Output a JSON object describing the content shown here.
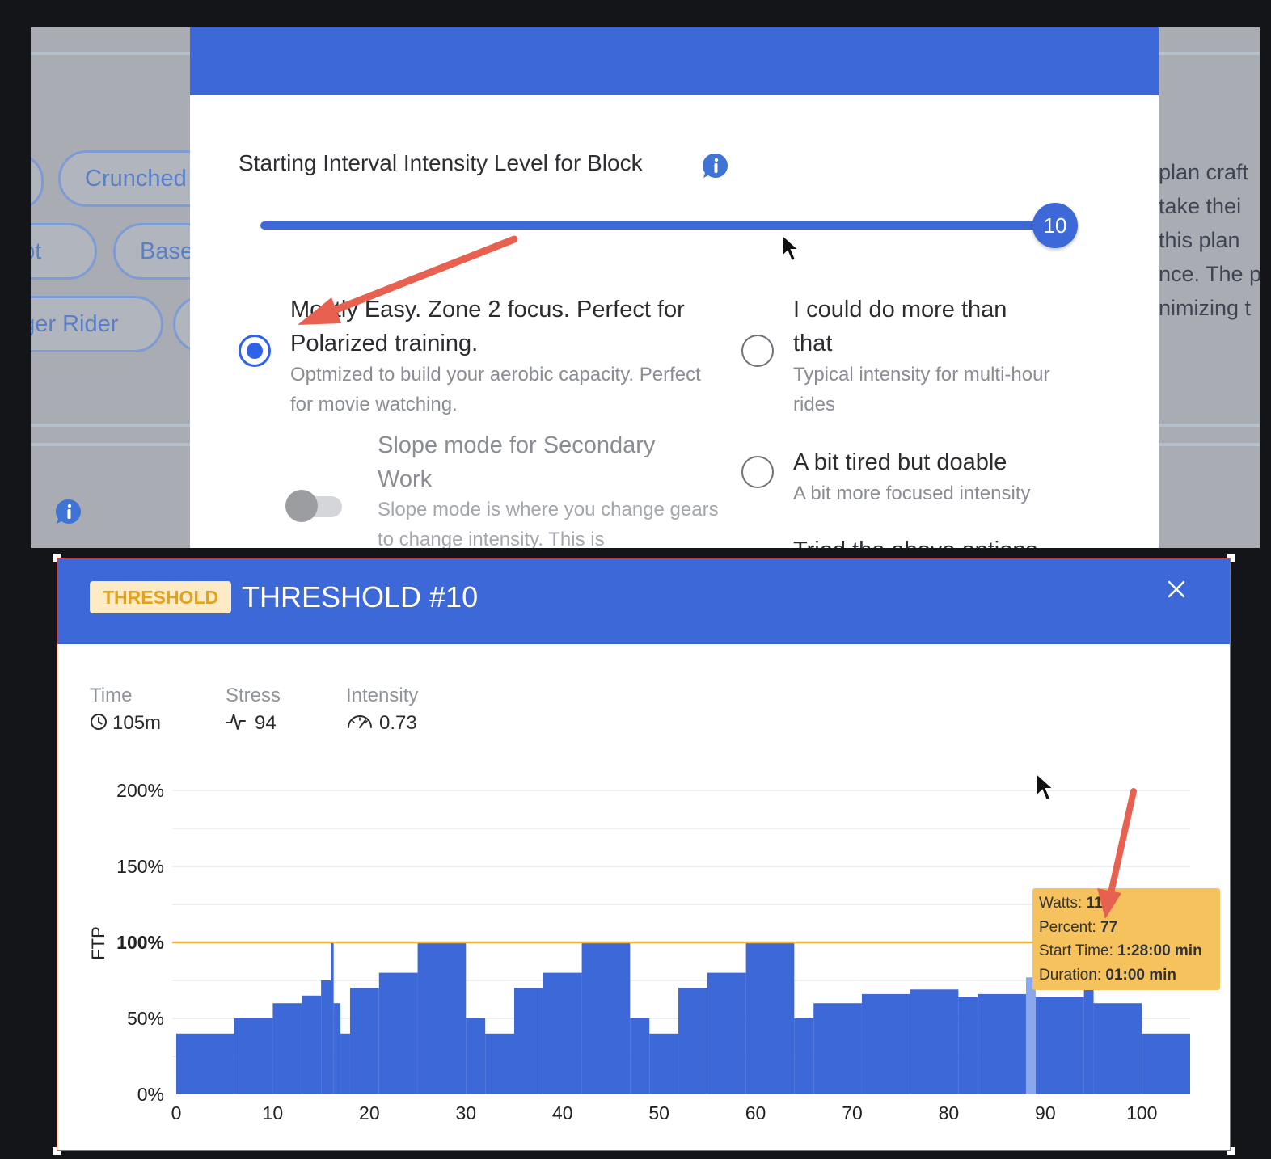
{
  "background_tags": {
    "row1": [
      "Crunched"
    ],
    "row2": [
      "pot",
      "Base"
    ],
    "row3": [
      "nger Rider"
    ]
  },
  "background_text": [
    "plan craft",
    "take thei",
    "this plan",
    "nce. The p",
    "nimizing t"
  ],
  "intensity_panel": {
    "title": "Starting Interval Intensity Level for Block",
    "slider_value": "10",
    "options": [
      {
        "title": "Mostly Easy. Zone 2 focus. Perfect for Polarized training.",
        "desc": "Optmized to build your aerobic capacity. Perfect for movie watching.",
        "selected": true
      },
      {
        "title": "I could do more than that",
        "desc": "Typical intensity for multi-hour rides",
        "selected": false
      },
      {
        "title": "A bit tired but doable",
        "desc": "A bit more focused intensity",
        "selected": false
      },
      {
        "title": "Tried the above options",
        "desc": "",
        "selected": false
      }
    ],
    "slope_mode": {
      "title": "Slope mode for Secondary Work",
      "desc": "Slope mode is where you change gears to change intensity. This is",
      "enabled": false
    }
  },
  "workout": {
    "badge": "THRESHOLD",
    "title": "THRESHOLD #10",
    "stats": [
      {
        "label": "Time",
        "value": "105m",
        "icon": "clock-icon"
      },
      {
        "label": "Stress",
        "value": "94",
        "icon": "pulse-icon"
      },
      {
        "label": "Intensity",
        "value": "0.73",
        "icon": "speedometer-icon"
      }
    ],
    "tooltip": {
      "watts_label": "Watts:",
      "watts_value": "11",
      "percent_label": "Percent:",
      "percent_value": "77",
      "start_label": "Start Time:",
      "start_value": "1:28:00 min",
      "duration_label": "Duration:",
      "duration_value": "01:00 min"
    }
  },
  "colors": {
    "accent": "#3d68d8",
    "ftp_line": "#f2b43c",
    "tooltip": "#f6c25d",
    "badge_text": "#e3a21c",
    "annotation_arrow": "#e8604f"
  },
  "chart_data": {
    "type": "area",
    "title": "",
    "xlabel": "",
    "ylabel": "FTP",
    "xlim": [
      0,
      105
    ],
    "ylim": [
      0,
      200
    ],
    "x_ticks": [
      0,
      10,
      20,
      30,
      40,
      50,
      60,
      70,
      80,
      90,
      100
    ],
    "y_ticks": [
      0,
      50,
      100,
      150,
      200
    ],
    "y_tick_labels": [
      "0%",
      "50%",
      "100%",
      "150%",
      "200%"
    ],
    "reference_line": {
      "y": 100,
      "label": "100%"
    },
    "highlight_segment": {
      "start": 88,
      "end": 89
    },
    "segments": [
      {
        "start": 0,
        "end": 6,
        "value": 40
      },
      {
        "start": 6,
        "end": 10,
        "value": 50
      },
      {
        "start": 10,
        "end": 13,
        "value": 60
      },
      {
        "start": 13,
        "end": 15,
        "value": 65
      },
      {
        "start": 15,
        "end": 16,
        "value": 75
      },
      {
        "start": 16,
        "end": 16.3,
        "value": 100
      },
      {
        "start": 16.3,
        "end": 17,
        "value": 60
      },
      {
        "start": 17,
        "end": 18,
        "value": 40
      },
      {
        "start": 18,
        "end": 21,
        "value": 70
      },
      {
        "start": 21,
        "end": 25,
        "value": 80
      },
      {
        "start": 25,
        "end": 30,
        "value": 100
      },
      {
        "start": 30,
        "end": 32,
        "value": 50
      },
      {
        "start": 32,
        "end": 35,
        "value": 40
      },
      {
        "start": 35,
        "end": 38,
        "value": 70
      },
      {
        "start": 38,
        "end": 42,
        "value": 80
      },
      {
        "start": 42,
        "end": 47,
        "value": 100
      },
      {
        "start": 47,
        "end": 49,
        "value": 50
      },
      {
        "start": 49,
        "end": 52,
        "value": 40
      },
      {
        "start": 52,
        "end": 55,
        "value": 70
      },
      {
        "start": 55,
        "end": 59,
        "value": 80
      },
      {
        "start": 59,
        "end": 64,
        "value": 100
      },
      {
        "start": 64,
        "end": 66,
        "value": 50
      },
      {
        "start": 66,
        "end": 71,
        "value": 60
      },
      {
        "start": 71,
        "end": 76,
        "value": 66
      },
      {
        "start": 76,
        "end": 81,
        "value": 69
      },
      {
        "start": 81,
        "end": 83,
        "value": 64
      },
      {
        "start": 83,
        "end": 88,
        "value": 66
      },
      {
        "start": 88,
        "end": 89,
        "value": 77
      },
      {
        "start": 89,
        "end": 94,
        "value": 64
      },
      {
        "start": 94,
        "end": 95,
        "value": 70
      },
      {
        "start": 95,
        "end": 100,
        "value": 60
      },
      {
        "start": 100,
        "end": 105,
        "value": 40
      }
    ]
  }
}
